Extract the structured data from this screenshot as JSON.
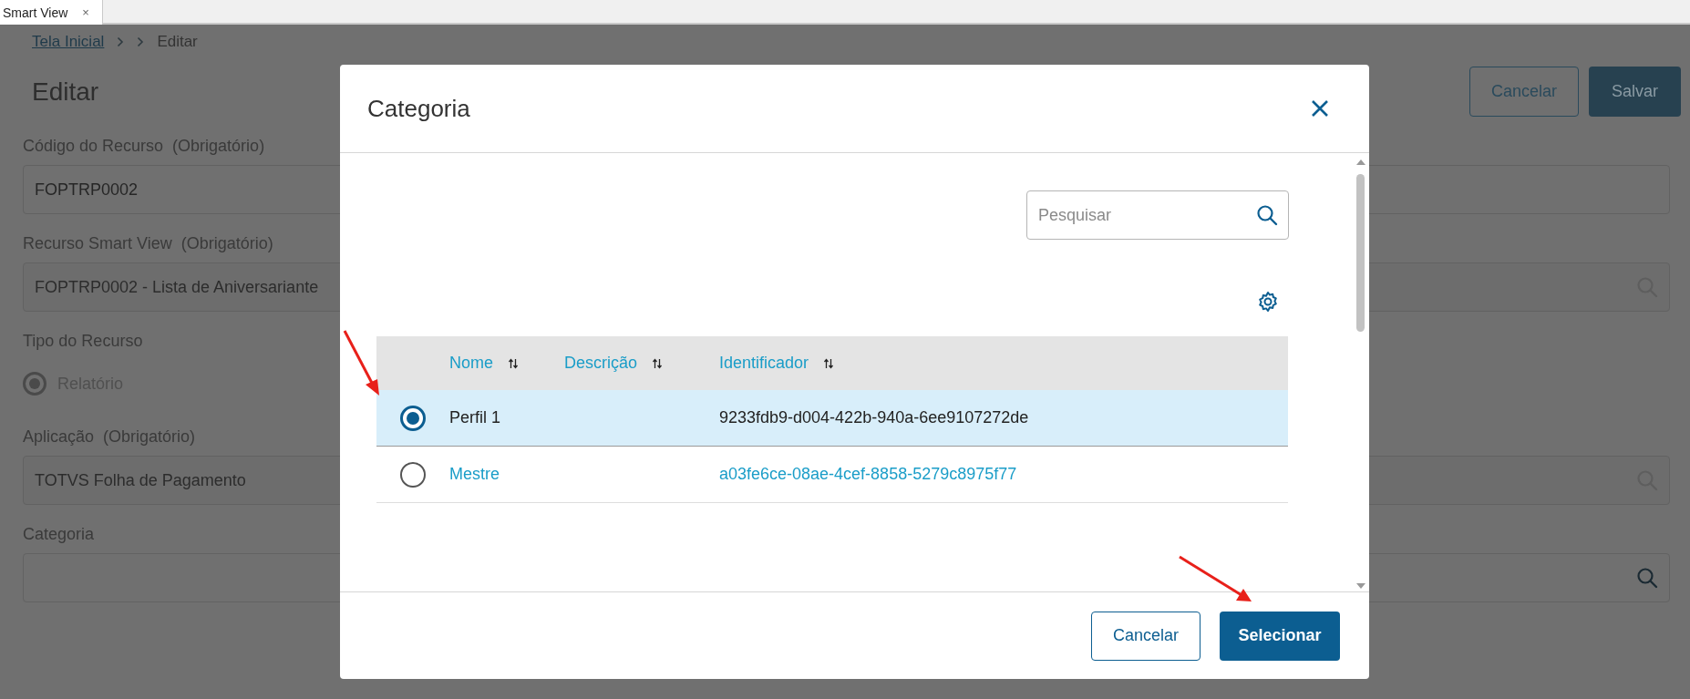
{
  "tab": {
    "label": "Smart View",
    "close": "×"
  },
  "breadcrumb": [
    {
      "kind": "link",
      "label": "Tela Inicial"
    },
    {
      "kind": "empty"
    },
    {
      "kind": "current",
      "label": "Editar"
    }
  ],
  "page": {
    "title": "Editar",
    "buttons": [
      {
        "kind": "secondary",
        "label": "Cancelar"
      },
      {
        "kind": "primary",
        "label": "Salvar"
      }
    ]
  },
  "fields": [
    {
      "kind": "text",
      "label": "Código do Recurso",
      "hint": "(Obrigatório)",
      "value": "FOPTRP0002"
    },
    {
      "kind": "lookup",
      "label": "Recurso Smart View",
      "hint": "(Obrigatório)",
      "value": "FOPTRP0002 - Lista de Aniversariante",
      "disabled": true
    },
    {
      "kind": "radio",
      "label": "Tipo do Recurso",
      "options": [
        {
          "label": "Relatório",
          "selected": true
        }
      ]
    },
    {
      "kind": "lookup",
      "label": "Aplicação",
      "hint": "(Obrigatório)",
      "value": "TOTVS Folha de Pagamento",
      "disabled": true
    },
    {
      "kind": "lookup",
      "label": "Categoria",
      "disabled": false
    }
  ],
  "modal": {
    "title": "Categoria",
    "search": {
      "placeholder": "Pesquisar"
    },
    "table": {
      "columns": [
        {
          "label": "Nome"
        },
        {
          "label": "Descrição"
        },
        {
          "label": "Identificador"
        }
      ],
      "rows": [
        {
          "selected": true,
          "cells": [
            "Perfil 1",
            "",
            "9233fdb9-d004-422b-940a-6ee9107272de"
          ]
        },
        {
          "selected": false,
          "cells": [
            "Mestre",
            "",
            "a03fe6ce-08ae-4cef-8858-5279c8975f77"
          ]
        }
      ]
    },
    "buttons": [
      {
        "kind": "secondary",
        "label": "Cancelar"
      },
      {
        "kind": "primary",
        "label": "Selecionar"
      }
    ]
  }
}
